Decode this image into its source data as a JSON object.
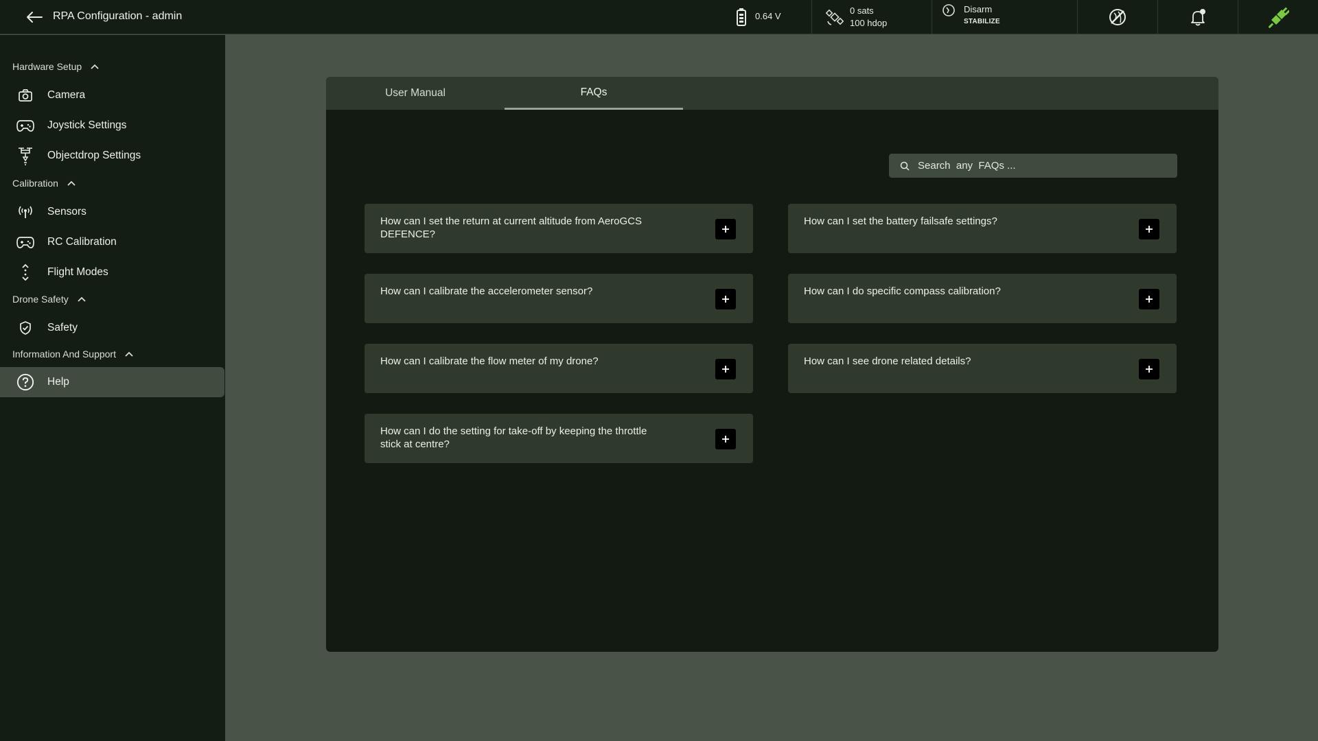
{
  "header": {
    "title": "RPA Configuration - admin",
    "battery": {
      "voltage": "0.64 V"
    },
    "gps": {
      "sats": "0 sats",
      "hdop": "100 hdop"
    },
    "arm": {
      "state": "Disarm",
      "mode": "STABILIZE"
    },
    "icons": [
      "back-arrow-icon",
      "battery-icon",
      "satellite-icon",
      "arm-status-icon",
      "no-gps-icon",
      "notification-bell-icon",
      "connection-plug-icon"
    ],
    "accent_color": "#7ac943"
  },
  "sidebar": {
    "sections": [
      {
        "title": "Hardware Setup",
        "items": [
          {
            "label": "Camera",
            "icon": "camera-icon"
          },
          {
            "label": "Joystick Settings",
            "icon": "gamepad-icon"
          },
          {
            "label": "Objectdrop Settings",
            "icon": "drone-drop-icon"
          }
        ]
      },
      {
        "title": "Calibration",
        "items": [
          {
            "label": "Sensors",
            "icon": "sensor-signal-icon"
          },
          {
            "label": "RC Calibration",
            "icon": "gamepad-icon"
          },
          {
            "label": "Flight Modes",
            "icon": "flight-modes-icon"
          }
        ]
      },
      {
        "title": "Drone Safety",
        "items": [
          {
            "label": "Safety",
            "icon": "shield-check-icon"
          }
        ]
      },
      {
        "title": "Information And Support",
        "items": [
          {
            "label": "Help",
            "icon": "help-circle-icon",
            "active": true
          }
        ]
      }
    ]
  },
  "main": {
    "tabs": [
      {
        "label": "User Manual",
        "active": false
      },
      {
        "label": "FAQs",
        "active": true
      }
    ],
    "search": {
      "placeholder": "Search  any  FAQs ..."
    },
    "faqs": [
      "How can I set the return at current altitude from AeroGCS DEFENCE?",
      "How can I set the battery failsafe settings?",
      "How can I calibrate the accelerometer sensor?",
      "How can I do specific compass calibration?",
      "How can I calibrate the flow meter of my drone?",
      "How can I see drone related details?",
      "How can I do the setting for take-off by keeping the throttle stick at centre?"
    ]
  }
}
